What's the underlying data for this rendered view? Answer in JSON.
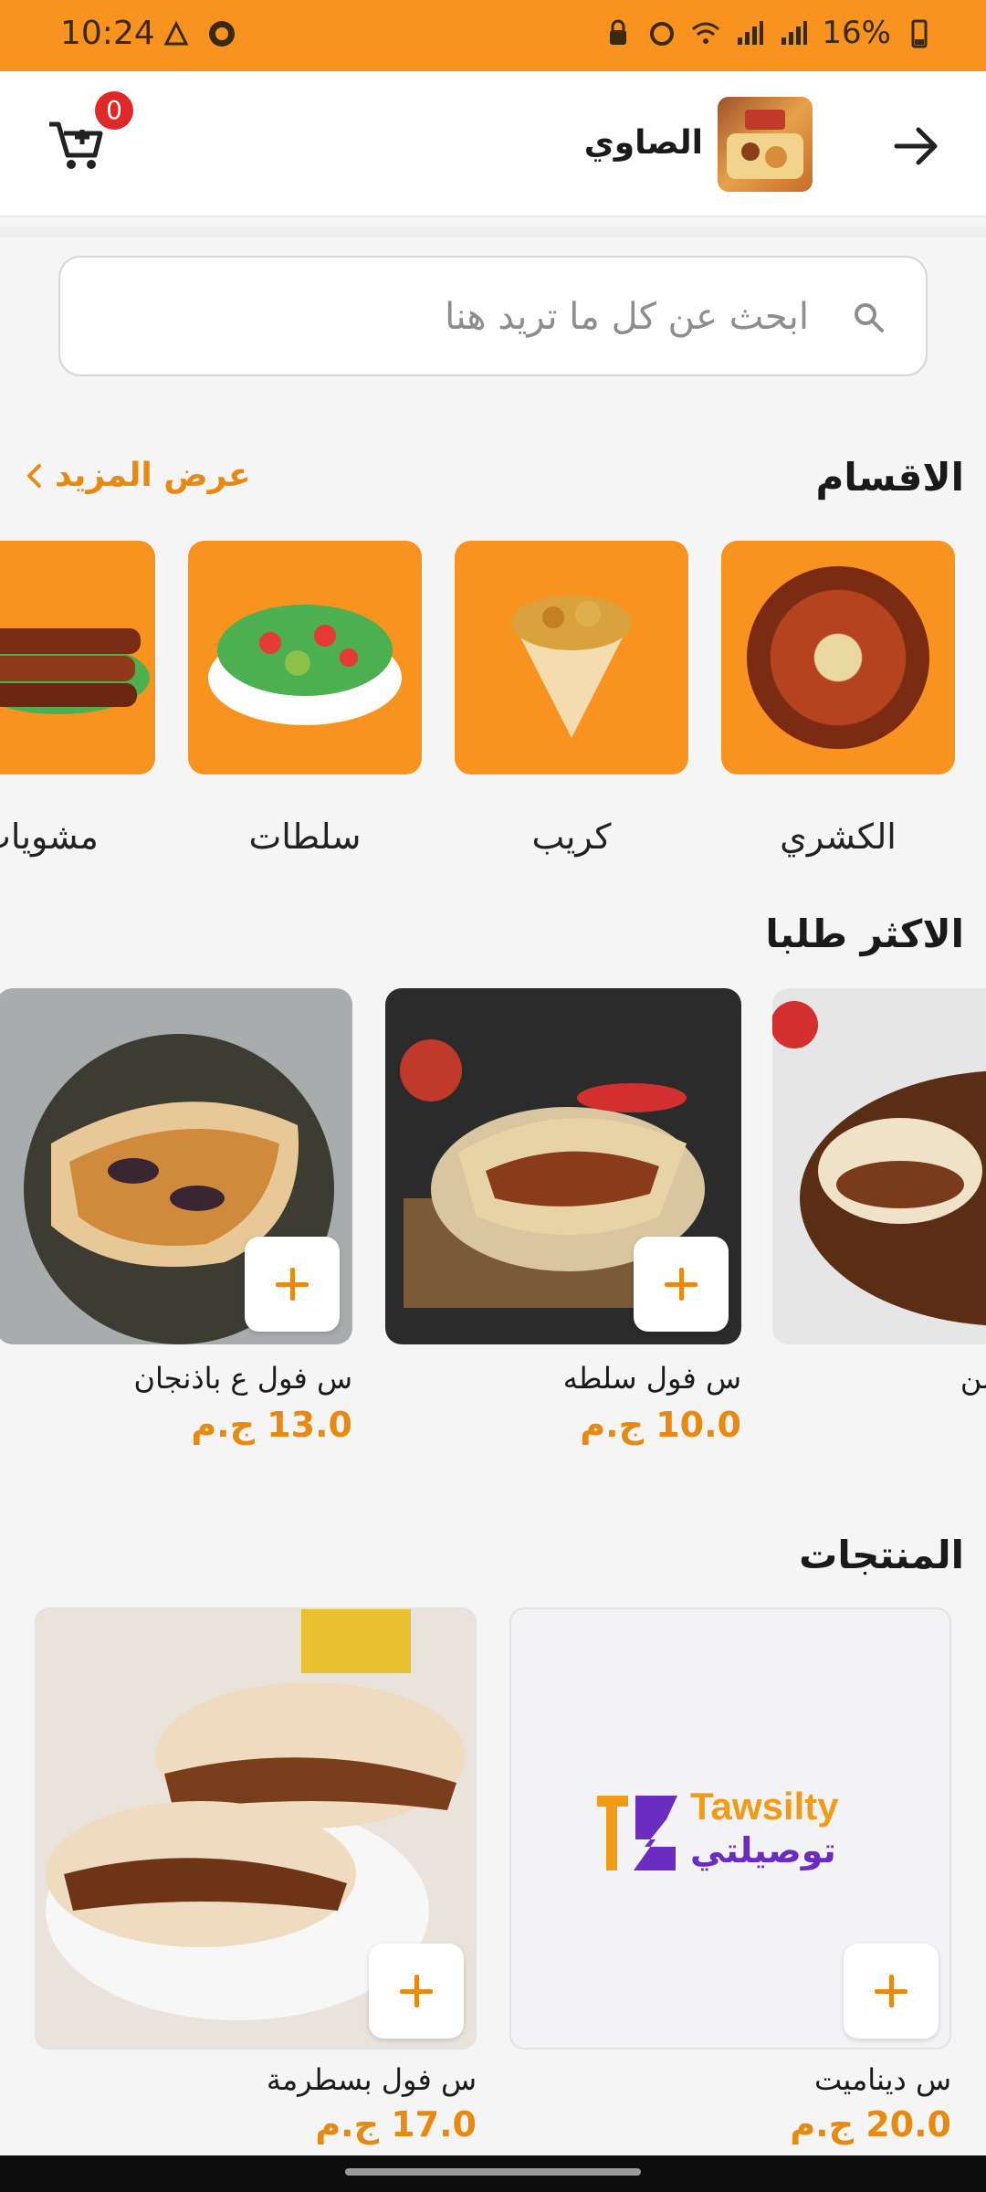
{
  "status_bar": {
    "time": "10:24",
    "battery": "16%"
  },
  "header": {
    "store_name": "الصاوي",
    "cart_count": "0"
  },
  "search": {
    "placeholder": "ابحث عن كل ما تريد هنا"
  },
  "categories_section": {
    "title": "الاقسام",
    "see_more": "عرض المزيد",
    "items": [
      {
        "label": "الكشري",
        "icon": "koshary-image"
      },
      {
        "label": "كريب",
        "icon": "crepe-image"
      },
      {
        "label": "سلطات",
        "icon": "salad-image"
      },
      {
        "label": "مشويات",
        "icon": "grill-image"
      }
    ]
  },
  "popular_section": {
    "title": "الاكثر طلبا",
    "items": [
      {
        "name": "س فول سلطه",
        "price": "10.0 ج.م"
      },
      {
        "name": "س فول ع باذنجان",
        "price": "13.0 ج.م"
      },
      {
        "name": "س فول سمن",
        "price": ""
      }
    ]
  },
  "products_section": {
    "title": "المنتجات",
    "items": [
      {
        "name": "س ديناميت",
        "price": "20.0 ج.م",
        "logo_text_en": "Tawsilty",
        "logo_text_ar": "توصيلتي"
      },
      {
        "name": "س فول بسطرمة",
        "price": "17.0 ج.م"
      }
    ]
  },
  "colors": {
    "accent": "#f7931e",
    "price": "#e88a12",
    "badge": "#e02828"
  }
}
